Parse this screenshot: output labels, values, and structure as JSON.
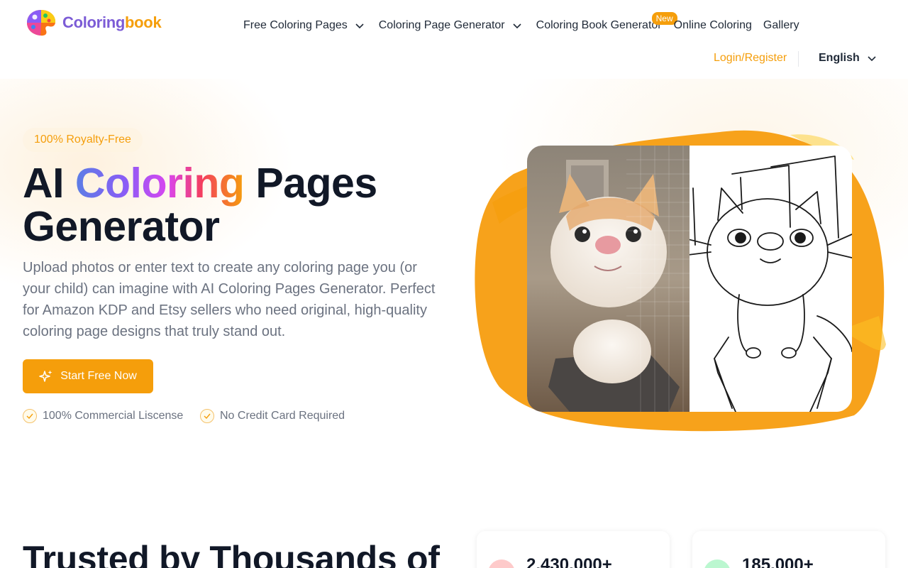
{
  "header": {
    "logo_part1": "Coloring",
    "logo_part2": "book",
    "nav": {
      "free_pages": "Free Coloring Pages",
      "page_generator": "Coloring Page Generator",
      "book_generator": "Coloring Book Generator",
      "new_badge": "New",
      "online": "Online Coloring",
      "gallery": "Gallery"
    },
    "login": "Login/Register",
    "language": "English"
  },
  "hero": {
    "badge": "100% Royalty-Free",
    "title_pre": "AI ",
    "title_gradient": "Coloring",
    "title_post": " Pages",
    "title_line2": "Generator",
    "description": "Upload photos or enter text to create any coloring page you (or your child) can imagine with AI Coloring Pages Generator. Perfect for Amazon KDP and Etsy sellers who need original, high-quality coloring page designs that truly stand out.",
    "cta": "Start Free Now",
    "features": [
      "100% Commercial Liscense",
      "No Credit Card Required"
    ]
  },
  "trusted": {
    "heading": "Trusted by Thousands of",
    "stats": [
      {
        "value": "2,430,000+",
        "color": "#fecaca"
      },
      {
        "value": "185,000+",
        "color": "#bbf7d0"
      }
    ]
  },
  "colors": {
    "accent": "#f59e0b",
    "text": "#111827",
    "muted": "#6b7280"
  }
}
